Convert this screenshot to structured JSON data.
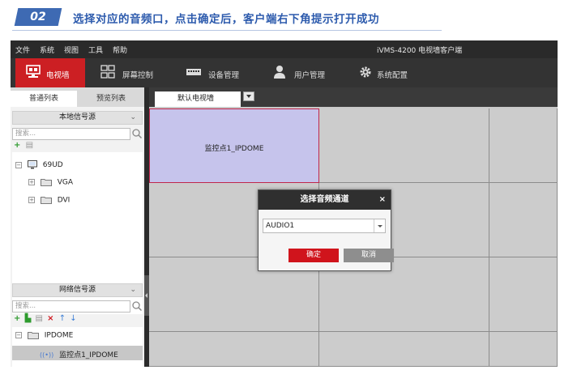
{
  "step": {
    "number": "02",
    "title": "选择对应的音频口，点击确定后，客户端右下角提示打开成功"
  },
  "app": {
    "title": "iVMS-4200 电视墙客户端",
    "menu": [
      "文件",
      "系统",
      "视图",
      "工具",
      "帮助"
    ],
    "nav": [
      {
        "label": "电视墙",
        "icon": "video-wall-icon",
        "active": true
      },
      {
        "label": "屏幕控制",
        "icon": "screen-grid-icon",
        "active": false
      },
      {
        "label": "设备管理",
        "icon": "device-icon",
        "active": false
      },
      {
        "label": "用户管理",
        "icon": "user-icon",
        "active": false
      },
      {
        "label": "系统配置",
        "icon": "gear-icon",
        "active": false
      }
    ]
  },
  "left_panel": {
    "tabs": [
      "普通列表",
      "预览列表"
    ],
    "local_source": {
      "header": "本地信号源",
      "search_placeholder": "搜索...",
      "tree": {
        "device": "69UD",
        "children": [
          "VGA",
          "DVI"
        ]
      }
    },
    "network_source": {
      "header": "网络信号源",
      "search_placeholder": "搜索...",
      "tree": {
        "group": "IPDOME",
        "child": "监控点1_IPDOME"
      }
    }
  },
  "main": {
    "wall_tab": "默认电视墙",
    "active_cell_label": "监控点1_IPDOME"
  },
  "dialog": {
    "title": "选择音频通道",
    "close": "×",
    "selected_value": "AUDIO1",
    "ok_label": "确定",
    "cancel_label": "取消"
  },
  "colors": {
    "accent": "#cc1f23",
    "step_blue": "#3e6ab3",
    "active_cell": "#c6c4ec"
  }
}
